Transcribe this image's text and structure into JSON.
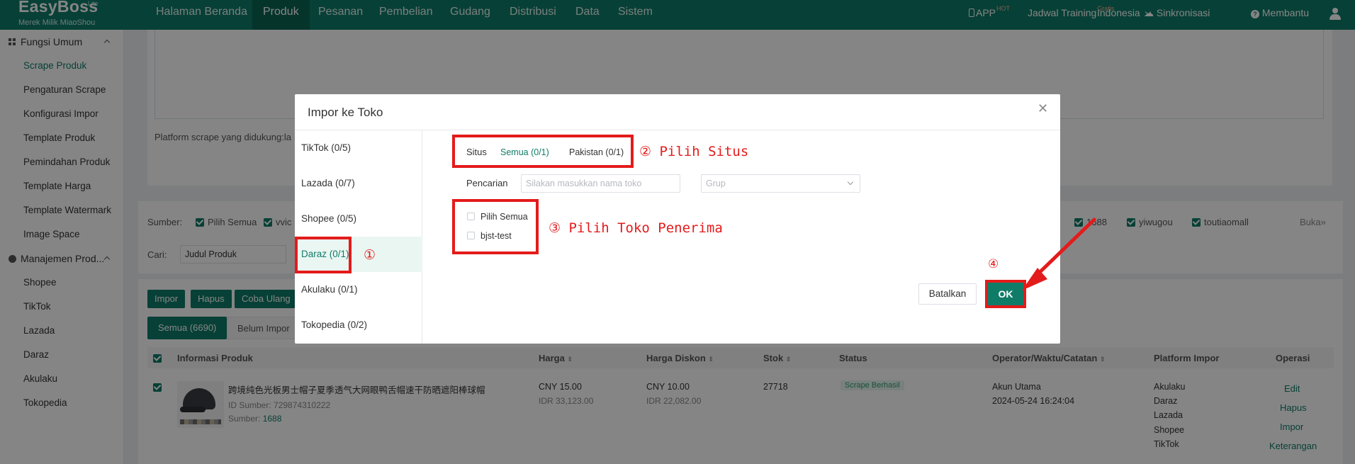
{
  "brand": {
    "name": "EasyBoss",
    "edition": "Lite",
    "tagline": "Merek Milik MiaoShou"
  },
  "nav": {
    "items": [
      "Halaman Beranda",
      "Produk",
      "Pesanan",
      "Pembelian",
      "Gudang",
      "Distribusi",
      "Data",
      "Sistem"
    ],
    "active": "Produk"
  },
  "topbar": {
    "app": "APP",
    "app_badge": "HOT",
    "training": "Jadwal Training",
    "training_badge": "Gratis",
    "language": "Indonesia",
    "sync": "Sinkronisasi",
    "help": "Membantu",
    "icons": [
      "phone-icon",
      "chevron-down-icon",
      "cloud-sync-icon",
      "help-circle-icon",
      "user-icon"
    ]
  },
  "sidebar": {
    "group1": "Fungsi Umum",
    "group1_items": [
      "Scrape Produk",
      "Pengaturan Scrape",
      "Konfigurasi Impor",
      "Template Produk",
      "Pemindahan Produk",
      "Template Harga",
      "Template Watermark",
      "Image Space"
    ],
    "group2": "Manajemen Prod...",
    "group2_items": [
      "Shopee",
      "TikTok",
      "Lazada",
      "Daraz",
      "Akulaku",
      "Tokopedia"
    ],
    "active": "Scrape Produk"
  },
  "background": {
    "platform_text": "Platform scrape yang didukung:la",
    "source_label": "Sumber:",
    "source_all": "Pilih Semua",
    "source_vvic": "vvic",
    "source_right": [
      "1688",
      "yiwugou",
      "toutiaomall"
    ],
    "expand": "Buka",
    "search_label": "Cari:",
    "search_field": "Judul Produk",
    "actions": [
      "Impor",
      "Hapus",
      "Coba Ulang"
    ],
    "tabs": [
      "Semua (6690)",
      "Belum Impor"
    ],
    "columns": [
      "Informasi Produk",
      "Harga",
      "Harga Diskon",
      "Stok",
      "Status",
      "Operator/Waktu/Catatan",
      "Platform Impor",
      "Operasi"
    ],
    "row": {
      "title": "跨境纯色光板男士帽子夏季透气大网眼鸭舌帽速干防晒遮阳棒球帽",
      "id_label": "ID Sumber:",
      "id": "729874310222",
      "source_label": "Sumber:",
      "source": "1688",
      "price": "CNY 15.00",
      "price_idr": "IDR 33,123.00",
      "discount": "CNY 10.00",
      "discount_idr": "IDR 22,082.00",
      "stock": "27718",
      "status": "Scrape Berhasil",
      "operator": "Akun Utama",
      "time": "2024-05-24 16:24:04",
      "platforms": [
        "Akulaku",
        "Daraz",
        "Lazada",
        "Shopee",
        "TikTok"
      ],
      "ops": [
        "Edit",
        "Hapus",
        "Impor",
        "Keterangan"
      ]
    }
  },
  "modal": {
    "title": "Impor ke Toko",
    "platform_tabs": [
      "TikTok (0/5)",
      "Lazada (0/7)",
      "Shopee (0/5)",
      "Daraz (0/1)",
      "Akulaku (0/1)",
      "Tokopedia (0/2)"
    ],
    "active_tab": "Daraz (0/1)",
    "site_label": "Situs",
    "site_options": [
      "Semua (0/1)",
      "Pakistan (0/1)"
    ],
    "search_label": "Pencarian",
    "search_placeholder": "Silakan masukkan nama toko",
    "group_placeholder": "Grup",
    "select_all": "Pilih Semua",
    "stores": [
      "bjst-test"
    ],
    "cancel": "Batalkan",
    "ok": "OK"
  },
  "annotations": {
    "a1": "①",
    "a2": "② Pilih Situs",
    "a3": "③ Pilih Toko Penerima",
    "a4": "④"
  },
  "colors": {
    "brand": "#0f7c68",
    "highlight": "#e41b1b"
  }
}
